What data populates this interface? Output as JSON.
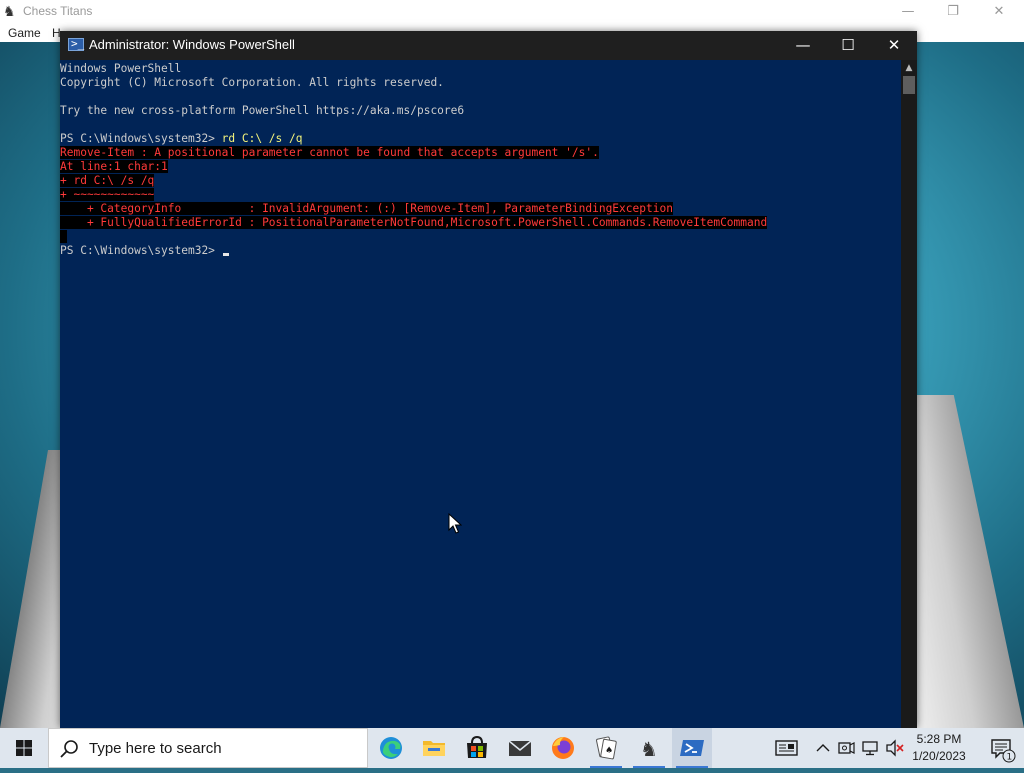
{
  "background_app": {
    "title": "Chess Titans",
    "menu": [
      "Game",
      "H"
    ],
    "controls": {
      "minimize": "—",
      "restore": "❐",
      "close": "✕"
    }
  },
  "powershell": {
    "title": "Administrator: Windows PowerShell",
    "controls": {
      "minimize": "—",
      "maximize": "☐",
      "close": "✕"
    },
    "lines": [
      {
        "text": "Windows PowerShell",
        "style": "normal"
      },
      {
        "text": "Copyright (C) Microsoft Corporation. All rights reserved.",
        "style": "normal"
      },
      {
        "text": "",
        "style": "normal"
      },
      {
        "text": "Try the new cross-platform PowerShell https://aka.ms/pscore6",
        "style": "normal"
      },
      {
        "text": "",
        "style": "normal"
      },
      {
        "prompt": "PS C:\\Windows\\system32> ",
        "command": "rd C:\\ /s /q",
        "style": "prompt"
      },
      {
        "text": "Remove-Item : A positional parameter cannot be found that accepts argument '/s'.",
        "style": "error"
      },
      {
        "text": "At line:1 char:1",
        "style": "error"
      },
      {
        "text": "+ rd C:\\ /s /q",
        "style": "error"
      },
      {
        "text": "+ ~~~~~~~~~~~~",
        "style": "error"
      },
      {
        "text": "    + CategoryInfo          : InvalidArgument: (:) [Remove-Item], ParameterBindingException",
        "style": "error"
      },
      {
        "text": "    + FullyQualifiedErrorId : PositionalParameterNotFound,Microsoft.PowerShell.Commands.RemoveItemCommand",
        "style": "error"
      },
      {
        "text": " ",
        "style": "error"
      },
      {
        "prompt": "PS C:\\Windows\\system32> ",
        "command": "",
        "style": "active-prompt"
      }
    ]
  },
  "taskbar": {
    "search_placeholder": "Type here to search",
    "apps": [
      "edge-icon",
      "file-explorer-icon",
      "microsoft-store-icon",
      "mail-icon",
      "firefox-icon",
      "solitaire-icon",
      "chess-titans-icon",
      "powershell-icon"
    ],
    "time": "5:28 PM",
    "date": "1/20/2023"
  },
  "colors": {
    "console_bg": "#012456",
    "console_fg": "#cccccc",
    "command": "#f4f47c",
    "error_fg": "#ff3a3a",
    "error_bg": "#000000"
  }
}
